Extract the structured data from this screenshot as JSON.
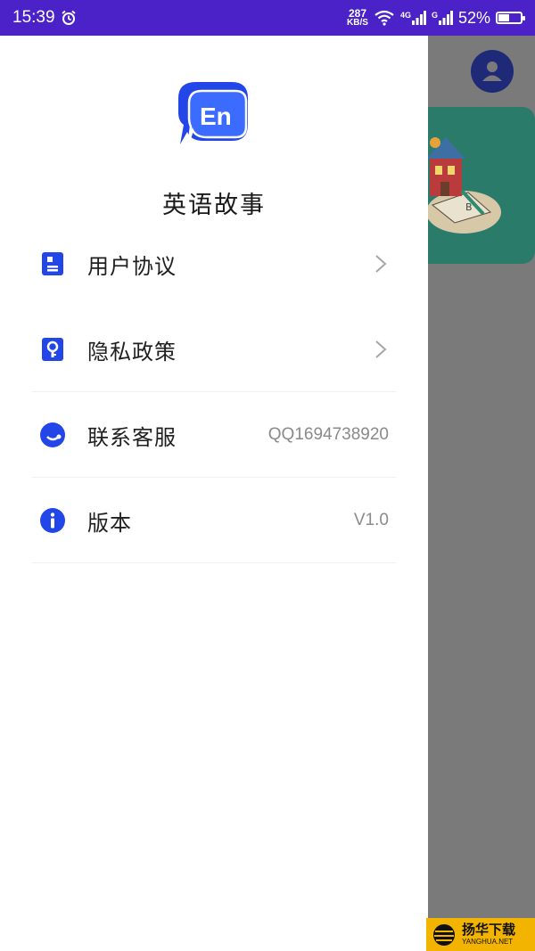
{
  "status_bar": {
    "time": "15:39",
    "net_speed_value": "287",
    "net_speed_unit": "KB/S",
    "network_4g": "4G",
    "network_g": "G",
    "battery": "52%",
    "battery_level": 0.52
  },
  "drawer": {
    "app_title": "英语故事",
    "logo_text": "En",
    "accent_color": "#2346e8",
    "items": [
      {
        "label": "用户协议",
        "value": "",
        "icon": "document-icon",
        "has_chevron": true
      },
      {
        "label": "隐私政策",
        "value": "",
        "icon": "lock-icon",
        "has_chevron": true
      },
      {
        "label": "联系客服",
        "value": "QQ1694738920",
        "icon": "contact-icon",
        "has_chevron": false
      },
      {
        "label": "版本",
        "value": "V1.0",
        "icon": "info-icon",
        "has_chevron": false
      }
    ]
  },
  "background": {
    "avatar_icon": "user-avatar-icon"
  },
  "watermark": {
    "cn": "扬华下载",
    "en": "YANGHUA.NET"
  }
}
